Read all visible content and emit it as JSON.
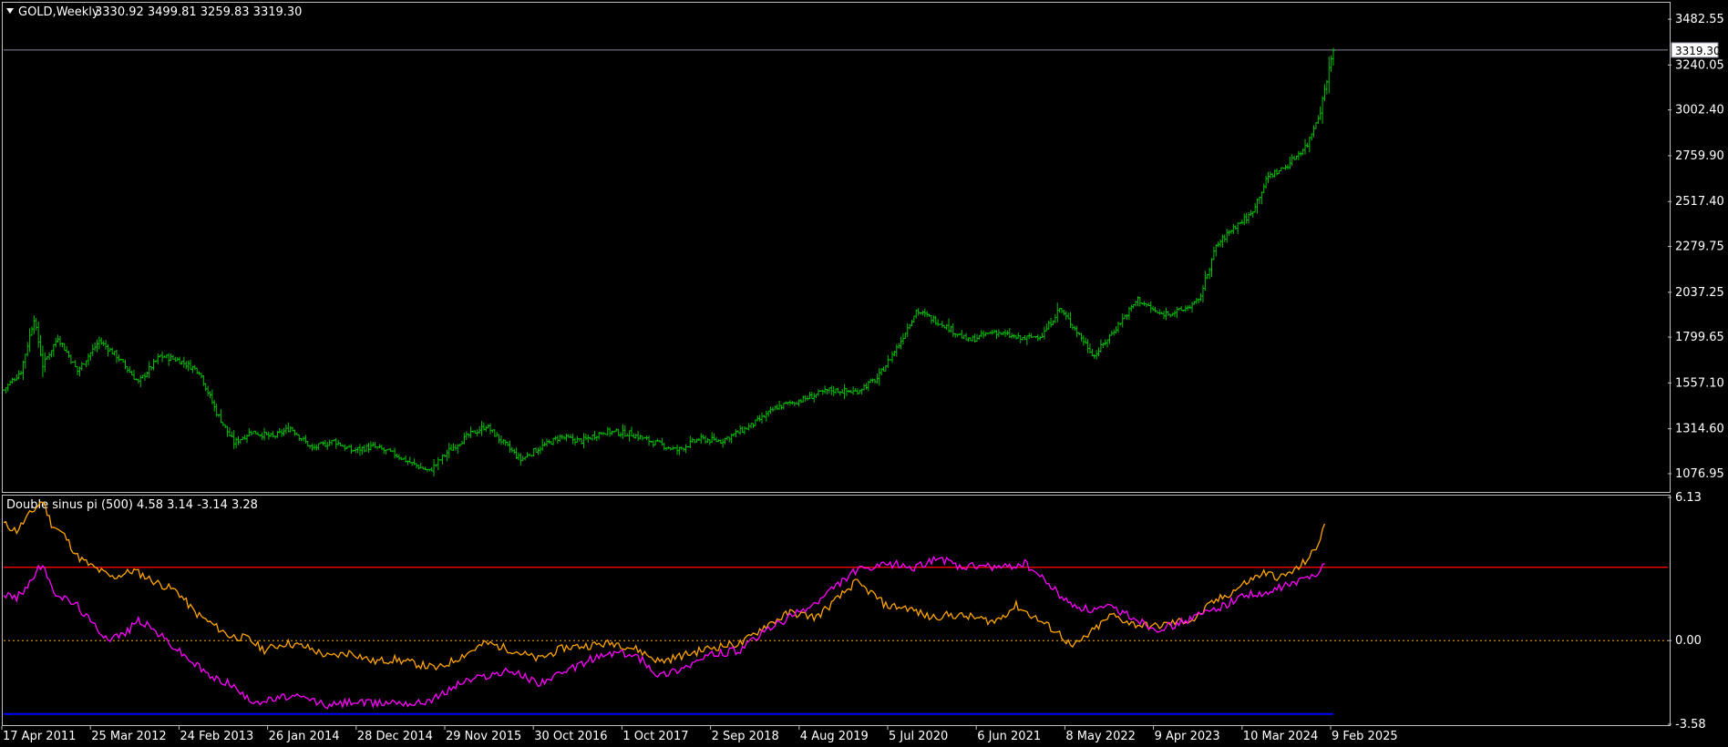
{
  "main_header": {
    "dropdown_icon": "triangle-down-icon",
    "symbol": "GOLD,Weekly",
    "ohlc": "3330.92 3499.81 3259.83 3319.30"
  },
  "indicator_header": "Double sinus pi (500) 4.58 3.14 -3.14 3.28",
  "current_price_label": "3319.30",
  "colors": {
    "background": "#000000",
    "frame": "#c0c0c0",
    "price_bars": "#00c000",
    "orange_line": "#ffa500",
    "magenta_line": "#ff00ff",
    "upper_level": "#ff0000",
    "lower_level": "#0000ff",
    "zero_level": "#ffa500",
    "price_line": "#8a8a9a"
  },
  "chart_data": [
    {
      "type": "ohlc",
      "title": "GOLD,Weekly",
      "current_price": 3319.3,
      "ylim": [
        990,
        3560
      ],
      "y_tick_labels": [
        "3482.55",
        "3240.05",
        "3002.40",
        "2759.90",
        "2517.40",
        "2279.75",
        "2037.25",
        "1799.65",
        "1557.10",
        "1314.60",
        "1076.95"
      ],
      "x_tick_labels": [
        "17 Apr 2011",
        "25 Mar 2012",
        "24 Feb 2013",
        "26 Jan 2014",
        "28 Dec 2014",
        "29 Nov 2015",
        "30 Oct 2016",
        "1 Oct 2017",
        "2 Sep 2018",
        "4 Aug 2019",
        "5 Jul 2020",
        "6 Jun 2021",
        "8 May 2022",
        "9 Apr 2023",
        "10 Mar 2024",
        "9 Feb 2025"
      ],
      "series": [
        {
          "close_path": [
            [
              0,
              1520
            ],
            [
              8,
              1620
            ],
            [
              14,
              1900
            ],
            [
              18,
              1650
            ],
            [
              25,
              1800
            ],
            [
              34,
              1620
            ],
            [
              44,
              1780
            ],
            [
              52,
              1700
            ],
            [
              62,
              1560
            ],
            [
              72,
              1700
            ],
            [
              80,
              1680
            ],
            [
              90,
              1620
            ],
            [
              98,
              1400
            ],
            [
              106,
              1240
            ],
            [
              114,
              1300
            ],
            [
              124,
              1270
            ],
            [
              132,
              1320
            ],
            [
              142,
              1210
            ],
            [
              152,
              1250
            ],
            [
              160,
              1200
            ],
            [
              170,
              1220
            ],
            [
              180,
              1180
            ],
            [
              188,
              1130
            ],
            [
              196,
              1090
            ],
            [
              205,
              1200
            ],
            [
              214,
              1280
            ],
            [
              222,
              1330
            ],
            [
              230,
              1240
            ],
            [
              238,
              1150
            ],
            [
              246,
              1210
            ],
            [
              256,
              1270
            ],
            [
              266,
              1250
            ],
            [
              276,
              1300
            ],
            [
              288,
              1290
            ],
            [
              300,
              1240
            ],
            [
              310,
              1200
            ],
            [
              320,
              1260
            ],
            [
              330,
              1250
            ],
            [
              344,
              1330
            ],
            [
              356,
              1430
            ],
            [
              368,
              1470
            ],
            [
              380,
              1520
            ],
            [
              392,
              1510
            ],
            [
              402,
              1580
            ],
            [
              412,
              1760
            ],
            [
              420,
              1940
            ],
            [
              432,
              1870
            ],
            [
              444,
              1780
            ],
            [
              456,
              1830
            ],
            [
              468,
              1790
            ],
            [
              478,
              1810
            ],
            [
              486,
              1950
            ],
            [
              494,
              1830
            ],
            [
              502,
              1700
            ],
            [
              512,
              1850
            ],
            [
              522,
              2000
            ],
            [
              532,
              1920
            ],
            [
              542,
              1940
            ],
            [
              550,
              1990
            ],
            [
              558,
              2280
            ],
            [
              566,
              2380
            ],
            [
              574,
              2450
            ],
            [
              582,
              2650
            ],
            [
              590,
              2700
            ],
            [
              600,
              2820
            ],
            [
              606,
              3000
            ],
            [
              612,
              3330
            ]
          ]
        }
      ]
    },
    {
      "type": "line",
      "title": "Double sinus pi (500)",
      "ylim": [
        -3.58,
        6.13
      ],
      "y_tick_labels": [
        "6.13",
        "0.00",
        "-3.58"
      ],
      "levels": [
        3.14,
        0.0,
        -3.14
      ],
      "series": [
        {
          "name": "4.58",
          "values": [
            [
              0,
              5.0
            ],
            [
              6,
              4.7
            ],
            [
              12,
              5.4
            ],
            [
              18,
              6.0
            ],
            [
              22,
              5.0
            ],
            [
              28,
              4.5
            ],
            [
              34,
              3.6
            ],
            [
              40,
              3.2
            ],
            [
              50,
              2.7
            ],
            [
              60,
              3.0
            ],
            [
              70,
              2.5
            ],
            [
              80,
              2.1
            ],
            [
              88,
              1.2
            ],
            [
              96,
              0.7
            ],
            [
              104,
              0.2
            ],
            [
              112,
              0.1
            ],
            [
              120,
              -0.4
            ],
            [
              130,
              -0.1
            ],
            [
              140,
              -0.3
            ],
            [
              150,
              -0.7
            ],
            [
              160,
              -0.5
            ],
            [
              170,
              -0.9
            ],
            [
              180,
              -0.8
            ],
            [
              190,
              -1.0
            ],
            [
              200,
              -1.2
            ],
            [
              210,
              -0.7
            ],
            [
              222,
              -0.1
            ],
            [
              234,
              -0.4
            ],
            [
              246,
              -0.8
            ],
            [
              258,
              -0.3
            ],
            [
              270,
              -0.2
            ],
            [
              282,
              -0.1
            ],
            [
              292,
              -0.4
            ],
            [
              302,
              -0.9
            ],
            [
              314,
              -0.6
            ],
            [
              326,
              -0.3
            ],
            [
              340,
              -0.1
            ],
            [
              350,
              0.6
            ],
            [
              362,
              1.2
            ],
            [
              374,
              1.0
            ],
            [
              384,
              1.8
            ],
            [
              392,
              2.5
            ],
            [
              400,
              2.0
            ],
            [
              406,
              1.5
            ],
            [
              416,
              1.4
            ],
            [
              426,
              1.0
            ],
            [
              436,
              1.1
            ],
            [
              446,
              1.0
            ],
            [
              456,
              0.8
            ],
            [
              466,
              1.5
            ],
            [
              476,
              0.9
            ],
            [
              486,
              0.3
            ],
            [
              492,
              -0.3
            ],
            [
              500,
              0.3
            ],
            [
              510,
              1.1
            ],
            [
              520,
              0.7
            ],
            [
              530,
              0.6
            ],
            [
              540,
              0.8
            ],
            [
              548,
              0.9
            ],
            [
              556,
              1.6
            ],
            [
              564,
              2.0
            ],
            [
              572,
              2.5
            ],
            [
              580,
              2.9
            ],
            [
              588,
              2.7
            ],
            [
              596,
              3.1
            ],
            [
              604,
              3.9
            ],
            [
              608,
              5.0
            ]
          ]
        },
        {
          "name": "3.28",
          "values": [
            [
              0,
              2.0
            ],
            [
              6,
              1.8
            ],
            [
              12,
              2.5
            ],
            [
              18,
              3.3
            ],
            [
              22,
              2.2
            ],
            [
              28,
              1.8
            ],
            [
              34,
              1.5
            ],
            [
              40,
              0.8
            ],
            [
              48,
              0.1
            ],
            [
              56,
              0.3
            ],
            [
              62,
              0.9
            ],
            [
              70,
              0.4
            ],
            [
              80,
              -0.4
            ],
            [
              88,
              -1.0
            ],
            [
              96,
              -1.6
            ],
            [
              104,
              -1.8
            ],
            [
              112,
              -2.5
            ],
            [
              120,
              -2.6
            ],
            [
              130,
              -2.4
            ],
            [
              140,
              -2.5
            ],
            [
              150,
              -2.8
            ],
            [
              160,
              -2.6
            ],
            [
              170,
              -2.7
            ],
            [
              180,
              -2.6
            ],
            [
              190,
              -2.7
            ],
            [
              200,
              -2.4
            ],
            [
              210,
              -1.8
            ],
            [
              222,
              -1.5
            ],
            [
              234,
              -1.3
            ],
            [
              246,
              -1.8
            ],
            [
              258,
              -1.4
            ],
            [
              270,
              -0.8
            ],
            [
              282,
              -0.5
            ],
            [
              292,
              -0.7
            ],
            [
              302,
              -1.5
            ],
            [
              314,
              -1.1
            ],
            [
              326,
              -0.6
            ],
            [
              340,
              -0.4
            ],
            [
              350,
              0.4
            ],
            [
              362,
              1.0
            ],
            [
              374,
              1.6
            ],
            [
              384,
              2.4
            ],
            [
              392,
              3.0
            ],
            [
              400,
              3.1
            ],
            [
              410,
              3.3
            ],
            [
              420,
              3.1
            ],
            [
              430,
              3.6
            ],
            [
              440,
              3.1
            ],
            [
              450,
              3.2
            ],
            [
              460,
              3.1
            ],
            [
              470,
              3.3
            ],
            [
              480,
              2.5
            ],
            [
              490,
              1.6
            ],
            [
              500,
              1.3
            ],
            [
              510,
              1.4
            ],
            [
              520,
              1.0
            ],
            [
              530,
              0.5
            ],
            [
              540,
              0.7
            ],
            [
              548,
              1.0
            ],
            [
              556,
              1.3
            ],
            [
              564,
              1.6
            ],
            [
              572,
              2.0
            ],
            [
              580,
              1.9
            ],
            [
              588,
              2.3
            ],
            [
              596,
              2.5
            ],
            [
              604,
              2.9
            ],
            [
              608,
              3.3
            ]
          ]
        }
      ]
    }
  ]
}
